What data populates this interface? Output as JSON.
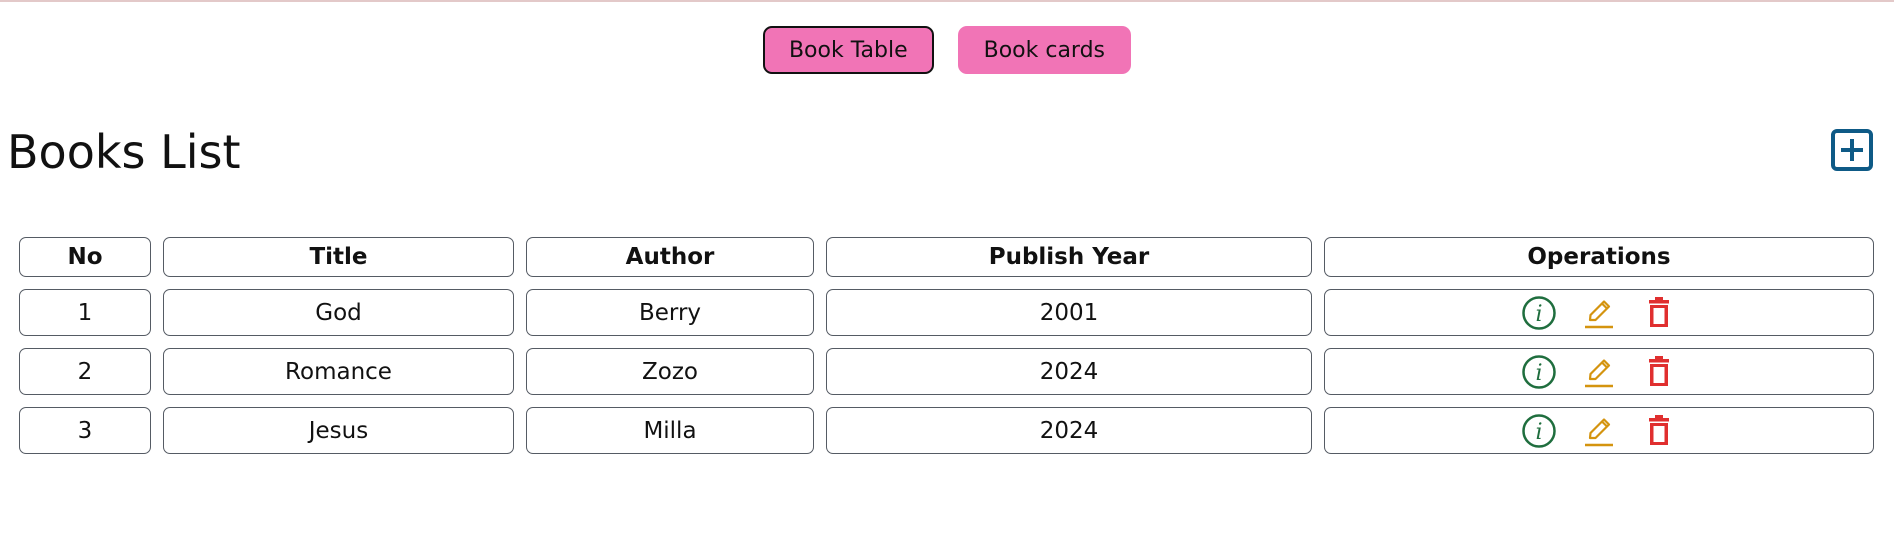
{
  "toggles": {
    "table_label": "Book Table",
    "cards_label": "Book cards"
  },
  "page": {
    "title": "Books List"
  },
  "table": {
    "headers": {
      "no": "No",
      "title": "Title",
      "author": "Author",
      "year": "Publish Year",
      "ops": "Operations"
    },
    "rows": [
      {
        "no": "1",
        "title": "God",
        "author": "Berry",
        "year": "2001"
      },
      {
        "no": "2",
        "title": "Romance",
        "author": "Zozo",
        "year": "2024"
      },
      {
        "no": "3",
        "title": "Jesus",
        "author": "Milla",
        "year": "2024"
      }
    ]
  },
  "icons": {
    "add": "plus-square-icon",
    "info": "info-circle-icon",
    "edit": "pencil-icon",
    "delete": "trash-icon"
  },
  "colors": {
    "toggle_bg": "#f174b6",
    "add": "#0e5a86",
    "info": "#1f6e3e",
    "edit": "#d4940f",
    "delete": "#e02f2f"
  }
}
